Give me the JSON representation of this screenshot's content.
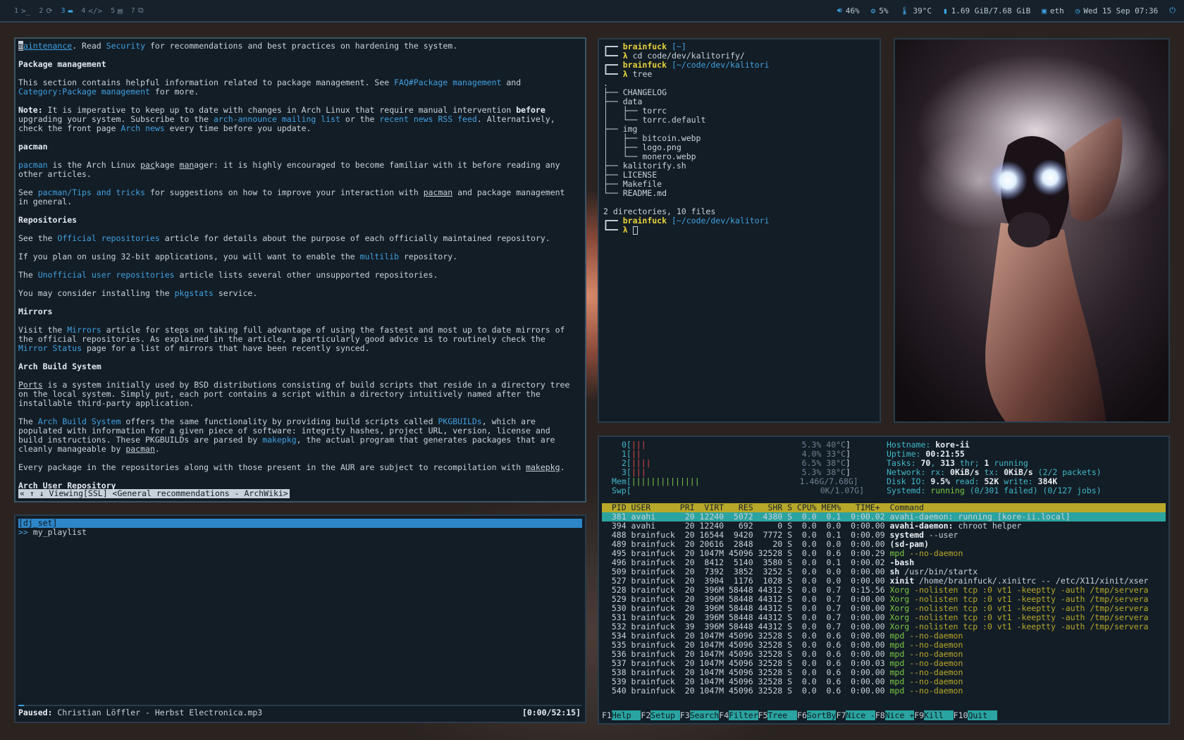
{
  "topbar": {
    "workspaces": [
      {
        "num": "1",
        "icon": ">_"
      },
      {
        "num": "2",
        "icon": "⟳"
      },
      {
        "num": "3",
        "icon": "▬"
      },
      {
        "num": "4",
        "icon": "</>"
      },
      {
        "num": "5",
        "icon": "▤"
      },
      {
        "num": "7",
        "icon": "⧉"
      }
    ],
    "volume": "46%",
    "cpu": "5%",
    "temp": "39°C",
    "memory": "1.69 GiB/7.68 GiB",
    "network": "eth",
    "datetime": "Wed 15 Sep 07:36"
  },
  "browser": {
    "first_line_cursor": "m",
    "first_line_link": "aintenance",
    "first_line_rest_1": ". Read ",
    "first_line_link2": "Security",
    "first_line_rest_2": " for recommendations and best practices on hardening the system.",
    "h_package_management": "Package management",
    "pm_text_1": "This section contains helpful information related to package management. See ",
    "pm_link_1": "FAQ#Package management",
    "pm_text_2": " and",
    "pm_link_2": "Category:Package management",
    "pm_text_3": " for more.",
    "note_label": "Note:",
    "note_text_1": " It is imperative to keep up to date with changes in Arch Linux that require manual intervention ",
    "note_before": "before",
    "note_text_2": "upgrading your system. Subscribe to the ",
    "note_link_1": "arch-announce mailing list",
    "note_text_3": " or the ",
    "note_link_2": "recent news RSS feed",
    "note_text_4": ". Alternatively,",
    "note_text_5": "check the front page ",
    "note_link_3": "Arch news",
    "note_text_6": " every time before you update.",
    "h_pacman": "pacman",
    "pacman_link": "pacman",
    "pacman_text_1": " is the Arch Linux ",
    "pacman_pac": "pac",
    "pacman_text_2": "kage ",
    "pacman_man": "man",
    "pacman_text_3": "ager: it is highly encouraged to become familiar with it before reading any",
    "pacman_text_4": "other articles.",
    "see_text_1": "See ",
    "see_link": "pacman/Tips and tricks",
    "see_text_2": " for suggestions on how to improve your interaction with ",
    "see_pacman": "pacman",
    "see_text_3": " and package management",
    "see_text_4": "in general.",
    "h_repositories": "Repositories",
    "repo_text_1": "See the ",
    "repo_link": "Official repositories",
    "repo_text_2": " article for details about the purpose of each officially maintained repository.",
    "multilib_text_1": "If you plan on using 32-bit applications, you will want to enable the ",
    "multilib_link": "multilib",
    "multilib_text_2": " repository.",
    "unof_text_1": "The ",
    "unof_link": "Unofficial user repositories",
    "unof_text_2": " article lists several other unsupported repositories.",
    "pkgstats_text_1": "You may consider installing the ",
    "pkgstats_link": "pkgstats",
    "pkgstats_text_2": " service.",
    "h_mirrors": "Mirrors",
    "mirrors_text_1": "Visit the ",
    "mirrors_link": "Mirrors",
    "mirrors_text_2": " article for steps on taking full advantage of using the fastest and most up to date mirrors of",
    "mirrors_text_3": "the official repositories. As explained in the article, a particularly good advice is to routinely check the",
    "mirrors_link2": "Mirror Status",
    "mirrors_text_4": " page for a list of mirrors that have been recently synced.",
    "h_abs": "Arch Build System",
    "ports_link": "Ports",
    "ports_text_1": " is a system initially used by BSD distributions consisting of build scripts that reside in a directory tree",
    "ports_text_2": "on the local system. Simply put, each port contains a script within a directory intuitively named after the",
    "ports_text_3": "installable third-party application.",
    "abs_text_1": "The ",
    "abs_link": "Arch Build System",
    "abs_text_2": " offers the same functionality by providing build scripts called ",
    "abs_link2": "PKGBUILDs",
    "abs_text_3": ", which are",
    "abs_text_4": "populated with information for a given piece of software: integrity hashes, project URL, version, license and",
    "abs_text_5": "build instructions. These PKGBUILDs are parsed by ",
    "abs_link3": "makepkg",
    "abs_text_6": ", the actual program that generates packages that are",
    "abs_text_7": "cleanly manageable by ",
    "abs_pacman": "pacman",
    "abs_text_8": ".",
    "every_text_1": "Every package in the repositories along with those present in the AUR are subject to recompilation with ",
    "every_makepkg": "makepkg",
    "every_text_2": ".",
    "h_aur": "Arch User Repository",
    "status": "« ↑ ↓ Viewing[SSL] <General recommendations - ArchWiki>"
  },
  "player": {
    "selected": "[dj_set]",
    "item_arrow": ">>",
    "item": "my_playlist",
    "progress": 0.01,
    "status_label": "Paused:",
    "track": "Christian Löffler -  Herbst Electronica.mp3",
    "time": "[0:00/52:15]"
  },
  "terminal": {
    "user1": "brainfuck",
    "dir1": "[~]",
    "cmd1": "cd code/dev/kalitorify/",
    "user2": "brainfuck",
    "dir2": "[~/code/dev/kalitori",
    "cmd2": "tree",
    "tree": [
      ".",
      "├── CHANGELOG",
      "├── data",
      "│   ├── torrc",
      "│   └── torrc.default",
      "├── img",
      "│   ├── bitcoin.webp",
      "│   ├── logo.png",
      "│   └── monero.webp",
      "├── kalitorify.sh",
      "├── LICENSE",
      "├── Makefile",
      "└── README.md"
    ],
    "summary": "2 directories, 10 files",
    "user3": "brainfuck",
    "dir3": "[~/code/dev/kalitori",
    "lambda": "λ",
    "branch_top": "┏━━",
    "branch_bot": "┗━━"
  },
  "htop": {
    "cpus": [
      {
        "label": "0[",
        "bars": "|||",
        "pct": "5.3%",
        "temp": "40°C"
      },
      {
        "label": "1[",
        "bars": "||",
        "pct": "4.0%",
        "temp": "33°C"
      },
      {
        "label": "2[",
        "bars": "||||",
        "pct": "6.5%",
        "temp": "38°C"
      },
      {
        "label": "3[",
        "bars": "|||",
        "pct": "5.3%",
        "temp": "38°C"
      }
    ],
    "mem_label": "Mem[",
    "mem_bars": "||||||||||||||",
    "mem_val": "1.46G/7.68G]",
    "swp_label": "Swp[",
    "swp_val": "0K/1.07G]",
    "hostname_label": "Hostname: ",
    "hostname": "kore-ii",
    "uptime_label": "Uptime: ",
    "uptime": "00:21:55",
    "tasks_label": "Tasks: ",
    "tasks": "70",
    "thr": "313",
    "thr_label": " thr; ",
    "running": "1",
    "running_label": " running",
    "network_label": "Network: rx: ",
    "network_rx": "0KiB/s",
    "network_tx_label": " tx: ",
    "network_tx": "0KiB/s",
    "network_pkts": " (2/2 packets)",
    "disk_label": "Disk IO: ",
    "disk_pct": "9.5%",
    "disk_read_label": " read: ",
    "disk_read": "52K",
    "disk_write_label": " write: ",
    "disk_write": "384K",
    "systemd_label": "Systemd: ",
    "systemd_state": "running",
    "systemd_failed": " (0/301 failed) (0/127 jobs)",
    "header": "  PID USER      PRI  VIRT   RES   SHR S CPU% MEM%   TIME+  Command",
    "rows": [
      {
        "pid": "381",
        "user": "avahi",
        "pri": "20",
        "virt": "12240",
        "res": "5072",
        "shr": "4380",
        "s": "S",
        "cpu": "0.0",
        "mem": "0.1",
        "time": "0:00.02",
        "cmd": "avahi-daemon: running [kore-ii.local]",
        "arg": ""
      },
      {
        "pid": "394",
        "user": "avahi",
        "pri": "20",
        "virt": "12240",
        "res": "692",
        "shr": "0",
        "s": "S",
        "cpu": "0.0",
        "mem": "0.0",
        "time": "0:00.00",
        "cmd": "avahi-daemon:",
        "arg": " chroot helper"
      },
      {
        "pid": "488",
        "user": "brainfuck",
        "pri": "20",
        "virt": "16544",
        "res": "9420",
        "shr": "7772",
        "s": "S",
        "cpu": "0.0",
        "mem": "0.1",
        "time": "0:00.09",
        "cmd": "systemd",
        "arg": " --user"
      },
      {
        "pid": "489",
        "user": "brainfuck",
        "pri": "20",
        "virt": "20616",
        "res": "2848",
        "shr": "20",
        "s": "S",
        "cpu": "0.0",
        "mem": "0.0",
        "time": "0:00.00",
        "cmd": "(sd-pam)",
        "arg": ""
      },
      {
        "pid": "495",
        "user": "brainfuck",
        "pri": "20",
        "virt": "1047M",
        "res": "45096",
        "shr": "32528",
        "s": "S",
        "cpu": "0.0",
        "mem": "0.6",
        "time": "0:00.29",
        "cmd": "mpd",
        "arg": " --no-daemon"
      },
      {
        "pid": "496",
        "user": "brainfuck",
        "pri": "20",
        "virt": "8412",
        "res": "5140",
        "shr": "3580",
        "s": "S",
        "cpu": "0.0",
        "mem": "0.1",
        "time": "0:00.02",
        "cmd": "-bash",
        "arg": ""
      },
      {
        "pid": "509",
        "user": "brainfuck",
        "pri": "20",
        "virt": "7392",
        "res": "3852",
        "shr": "3252",
        "s": "S",
        "cpu": "0.0",
        "mem": "0.0",
        "time": "0:00.00",
        "cmd": "sh",
        "arg": " /usr/bin/startx"
      },
      {
        "pid": "527",
        "user": "brainfuck",
        "pri": "20",
        "virt": "3904",
        "res": "1176",
        "shr": "1028",
        "s": "S",
        "cpu": "0.0",
        "mem": "0.0",
        "time": "0:00.00",
        "cmd": "xinit",
        "arg": " /home/brainfuck/.xinitrc -- /etc/X11/xinit/xser"
      },
      {
        "pid": "528",
        "user": "brainfuck",
        "pri": "20",
        "virt": "396M",
        "res": "58448",
        "shr": "44312",
        "s": "S",
        "cpu": "0.0",
        "mem": "0.7",
        "time": "0:15.56",
        "cmd": "Xorg",
        "arg": " -nolisten tcp :0 vt1 -keeptty -auth /tmp/servera"
      },
      {
        "pid": "529",
        "user": "brainfuck",
        "pri": "20",
        "virt": "396M",
        "res": "58448",
        "shr": "44312",
        "s": "S",
        "cpu": "0.0",
        "mem": "0.7",
        "time": "0:00.00",
        "cmd": "Xorg",
        "arg": " -nolisten tcp :0 vt1 -keeptty -auth /tmp/servera"
      },
      {
        "pid": "530",
        "user": "brainfuck",
        "pri": "20",
        "virt": "396M",
        "res": "58448",
        "shr": "44312",
        "s": "S",
        "cpu": "0.0",
        "mem": "0.7",
        "time": "0:00.00",
        "cmd": "Xorg",
        "arg": " -nolisten tcp :0 vt1 -keeptty -auth /tmp/servera"
      },
      {
        "pid": "531",
        "user": "brainfuck",
        "pri": "20",
        "virt": "396M",
        "res": "58448",
        "shr": "44312",
        "s": "S",
        "cpu": "0.0",
        "mem": "0.7",
        "time": "0:00.00",
        "cmd": "Xorg",
        "arg": " -nolisten tcp :0 vt1 -keeptty -auth /tmp/servera"
      },
      {
        "pid": "532",
        "user": "brainfuck",
        "pri": "39",
        "virt": "396M",
        "res": "58448",
        "shr": "44312",
        "s": "S",
        "cpu": "0.0",
        "mem": "0.7",
        "time": "0:00.00",
        "cmd": "Xorg",
        "arg": " -nolisten tcp :0 vt1 -keeptty -auth /tmp/servera"
      },
      {
        "pid": "534",
        "user": "brainfuck",
        "pri": "20",
        "virt": "1047M",
        "res": "45096",
        "shr": "32528",
        "s": "S",
        "cpu": "0.0",
        "mem": "0.6",
        "time": "0:00.00",
        "cmd": "mpd",
        "arg": " --no-daemon"
      },
      {
        "pid": "535",
        "user": "brainfuck",
        "pri": "20",
        "virt": "1047M",
        "res": "45096",
        "shr": "32528",
        "s": "S",
        "cpu": "0.0",
        "mem": "0.6",
        "time": "0:00.00",
        "cmd": "mpd",
        "arg": " --no-daemon"
      },
      {
        "pid": "536",
        "user": "brainfuck",
        "pri": "20",
        "virt": "1047M",
        "res": "45096",
        "shr": "32528",
        "s": "S",
        "cpu": "0.0",
        "mem": "0.6",
        "time": "0:00.00",
        "cmd": "mpd",
        "arg": " --no-daemon"
      },
      {
        "pid": "537",
        "user": "brainfuck",
        "pri": "20",
        "virt": "1047M",
        "res": "45096",
        "shr": "32528",
        "s": "S",
        "cpu": "0.0",
        "mem": "0.6",
        "time": "0:00.03",
        "cmd": "mpd",
        "arg": " --no-daemon"
      },
      {
        "pid": "538",
        "user": "brainfuck",
        "pri": "20",
        "virt": "1047M",
        "res": "45096",
        "shr": "32528",
        "s": "S",
        "cpu": "0.0",
        "mem": "0.6",
        "time": "0:00.00",
        "cmd": "mpd",
        "arg": " --no-daemon"
      },
      {
        "pid": "539",
        "user": "brainfuck",
        "pri": "20",
        "virt": "1047M",
        "res": "45096",
        "shr": "32528",
        "s": "S",
        "cpu": "0.0",
        "mem": "0.6",
        "time": "0:00.00",
        "cmd": "mpd",
        "arg": " --no-daemon"
      },
      {
        "pid": "540",
        "user": "brainfuck",
        "pri": "20",
        "virt": "1047M",
        "res": "45096",
        "shr": "32528",
        "s": "S",
        "cpu": "0.0",
        "mem": "0.6",
        "time": "0:00.00",
        "cmd": "mpd",
        "arg": " --no-daemon"
      }
    ],
    "fkeys": [
      {
        "k": "F1",
        "l": "Help  "
      },
      {
        "k": "F2",
        "l": "Setup "
      },
      {
        "k": "F3",
        "l": "Search"
      },
      {
        "k": "F4",
        "l": "Filter"
      },
      {
        "k": "F5",
        "l": "Tree  "
      },
      {
        "k": "F6",
        "l": "SortBy"
      },
      {
        "k": "F7",
        "l": "Nice -"
      },
      {
        "k": "F8",
        "l": "Nice +"
      },
      {
        "k": "F9",
        "l": "Kill  "
      },
      {
        "k": "F10",
        "l": "Quit  "
      }
    ]
  },
  "colors": {
    "accent": "#3fa0e0",
    "panel": "#131d26",
    "prompt_user": "#e6d13c",
    "htop_header": "#b8a82a",
    "htop_select": "#2ba3a0"
  }
}
